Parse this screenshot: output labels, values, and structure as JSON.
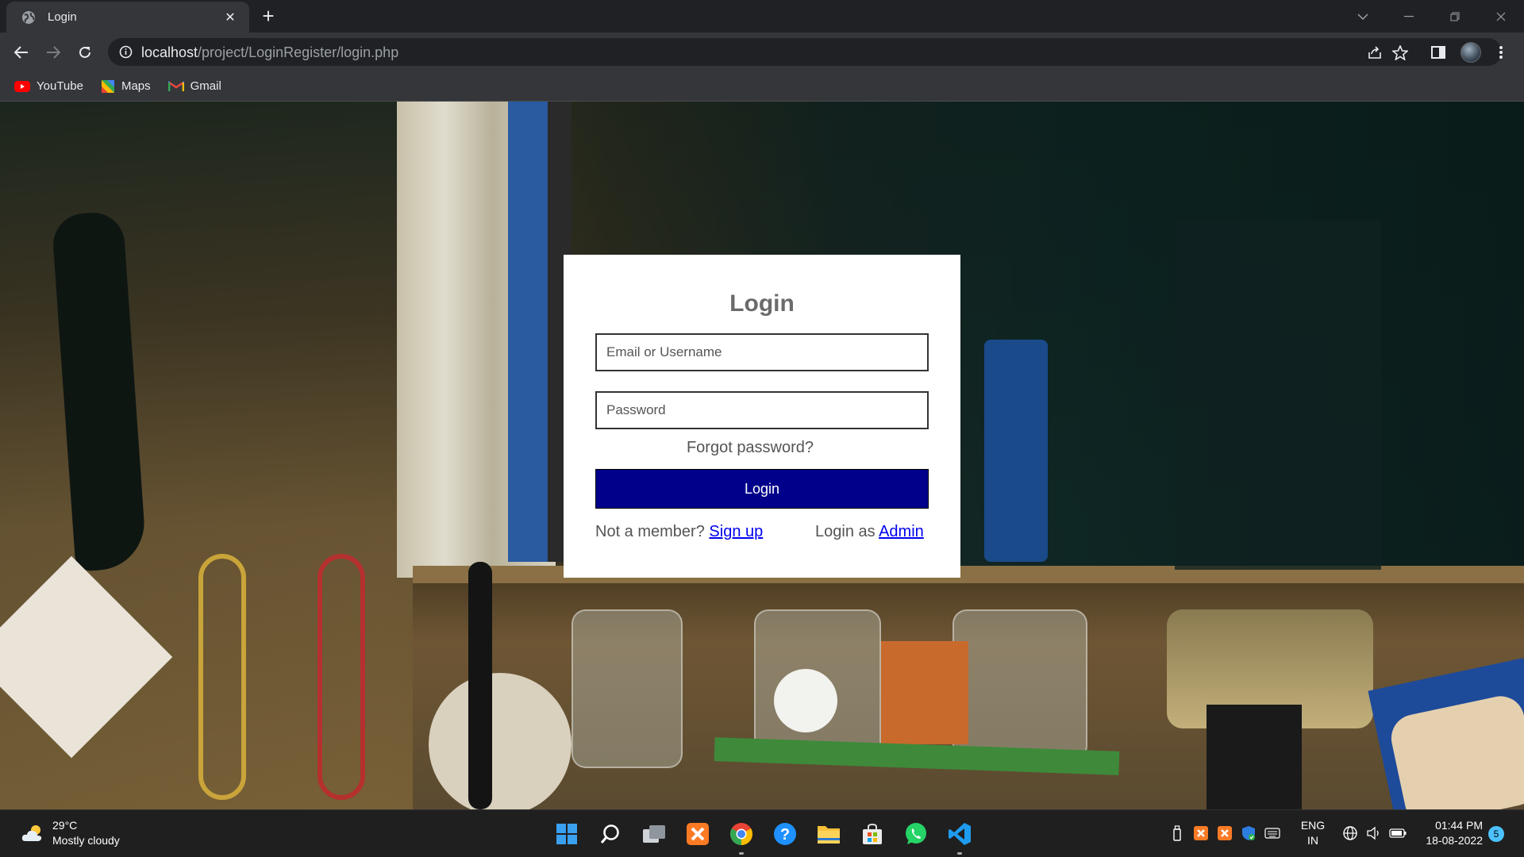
{
  "browser": {
    "tab_title": "Login",
    "url_host": "localhost",
    "url_path": "/project/LoginRegister/login.php",
    "bookmarks": [
      {
        "label": "YouTube",
        "icon": "youtube-icon"
      },
      {
        "label": "Maps",
        "icon": "maps-icon"
      },
      {
        "label": "Gmail",
        "icon": "gmail-icon"
      }
    ]
  },
  "login": {
    "title": "Login",
    "email_placeholder": "Email or Username",
    "password_placeholder": "Password",
    "forgot": "Forgot password?",
    "button": "Login",
    "not_member": "Not a member?",
    "signup": "Sign up",
    "login_as": "Login as",
    "admin": "Admin",
    "button_color": "#00008b"
  },
  "taskbar": {
    "temperature": "29°C",
    "weather": "Mostly cloudy",
    "lang_1": "ENG",
    "lang_2": "IN",
    "time": "01:44 PM",
    "date": "18-08-2022",
    "notifications": "5",
    "apps": [
      "windows-start-icon",
      "search-icon",
      "task-view-icon",
      "xampp-icon",
      "chrome-icon",
      "help-icon",
      "file-explorer-icon",
      "microsoft-store-icon",
      "whatsapp-icon",
      "vscode-icon"
    ]
  }
}
